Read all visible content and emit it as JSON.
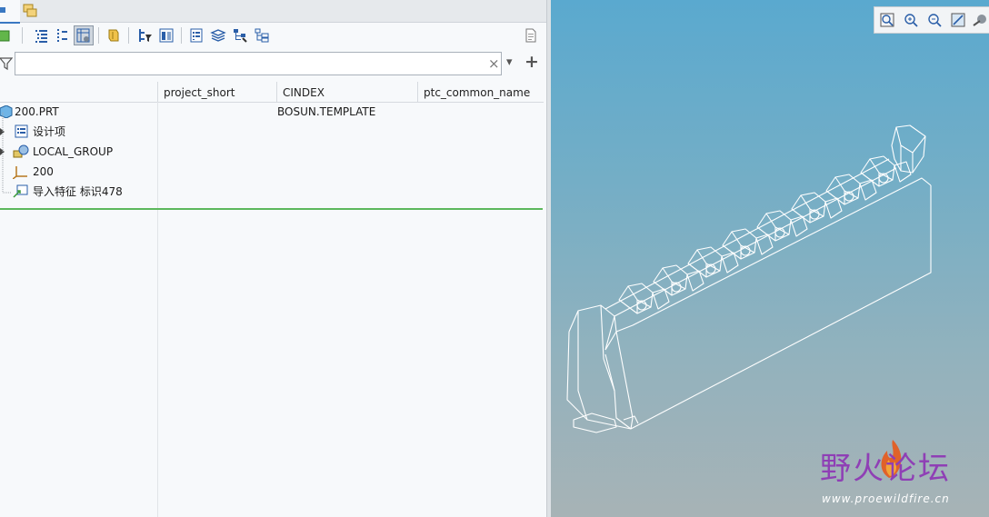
{
  "toolbar": {
    "icons": [
      "box-icon",
      "tree-columns-icon",
      "tree-dots-icon",
      "tree-settings-icon",
      "feature-shield-icon",
      "filter-tree-icon",
      "model-tree-icon",
      "list-icon",
      "layers-icon",
      "tree-branch-icon",
      "tree-table-icon",
      "document-icon"
    ]
  },
  "filter": {
    "value": "",
    "clear_glyph": "×",
    "dropdown_glyph": "▾",
    "add_glyph": "+"
  },
  "columns": {
    "col1": "project_short",
    "col2": "CINDEX",
    "col3": "ptc_common_name"
  },
  "tree": {
    "rows": [
      {
        "label": "200.PRT",
        "icon": "part-icon",
        "cindex": "BOSUN.TEMPLATE"
      },
      {
        "label": "设计项",
        "icon": "design-items-icon",
        "cindex": ""
      },
      {
        "label": "LOCAL_GROUP",
        "icon": "group-icon",
        "cindex": ""
      },
      {
        "label": "200",
        "icon": "coordinate-system-icon",
        "cindex": ""
      },
      {
        "label": "导入特征 标识478",
        "icon": "import-feature-icon",
        "cindex": ""
      }
    ]
  },
  "watermark": {
    "title": "野火论坛",
    "url": "www.proewildfire.cn"
  },
  "colors": {
    "accent_green": "#5cb85c",
    "viewport_top": "#5aa9cf",
    "viewport_bottom": "#a7b3b6",
    "model_lines": "#ffffff"
  }
}
